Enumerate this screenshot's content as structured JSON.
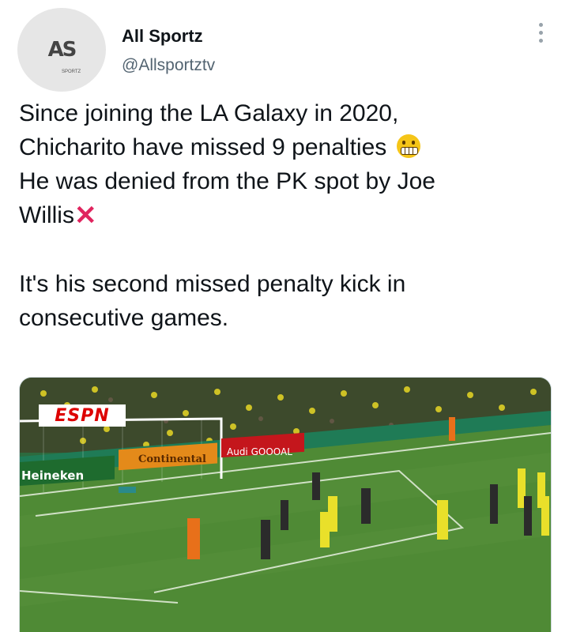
{
  "author": {
    "display_name": "All Sportz",
    "handle": "@Allsportztv",
    "avatar_text": "AS",
    "avatar_sub": "SPORTZ"
  },
  "tweet": {
    "line1": "Since joining the LA Galaxy in 2020,",
    "line2": "Chicharito have missed 9 penalties",
    "line2_emoji": "grimacing-face-emoji",
    "line3": "He was denied from the PK spot by Joe",
    "line4": "Willis",
    "line4_emoji": "cross-mark-emoji",
    "line5": "It's his second missed penalty kick in",
    "line6": "consecutive games."
  },
  "media": {
    "broadcaster_logo": "ESPN",
    "boards": [
      "Heineken",
      "Continental",
      "Audi GOOOAL"
    ],
    "description_icon": "soccer-match-photo"
  },
  "colors": {
    "handle": "#536471",
    "pitch": "#4a7d2e",
    "espn": "#dd0000",
    "cross": "#e0245e"
  }
}
